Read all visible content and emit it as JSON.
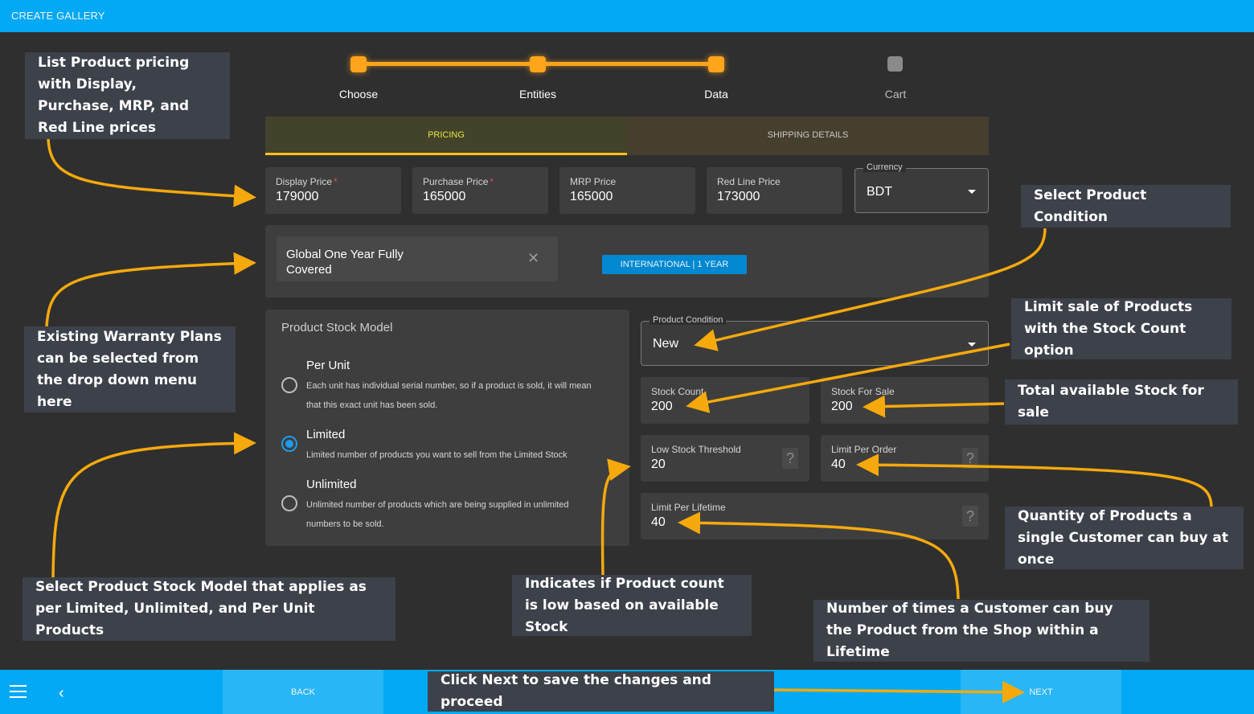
{
  "app": {
    "title": "CREATE GALLERY"
  },
  "stepper": {
    "steps": [
      {
        "label": "Choose",
        "state": "complete"
      },
      {
        "label": "Entities",
        "state": "complete"
      },
      {
        "label": "Data",
        "state": "current"
      },
      {
        "label": "Cart",
        "state": "inactive"
      }
    ]
  },
  "tabs": [
    {
      "label": "PRICING",
      "active": true
    },
    {
      "label": "SHIPPING DETAILS",
      "active": false
    }
  ],
  "pricing": {
    "display_price": {
      "label": "Display Price",
      "required": "*",
      "value": "179000"
    },
    "purchase_price": {
      "label": "Purchase Price",
      "required": "*",
      "value": "165000"
    },
    "mrp_price": {
      "label": "MRP Price",
      "value": "165000"
    },
    "red_line_price": {
      "label": "Red Line Price",
      "value": "173000"
    },
    "currency": {
      "label": "Currency",
      "value": "BDT"
    }
  },
  "warranty": {
    "selected": "Global One Year Fully Covered",
    "remove_icon": "close-icon",
    "badge": "INTERNATIONAL | 1 YEAR"
  },
  "stock_model": {
    "title": "Product Stock Model",
    "selected": "Limited",
    "options": [
      {
        "title": "Per Unit",
        "description": "Each unit has individual serial number, so if a product is sold, it will mean that this exact unit has been sold.",
        "checked": false
      },
      {
        "title": "Limited",
        "description": "Limited number of products you want to sell from the Limited Stock",
        "checked": true
      },
      {
        "title": "Unlimited",
        "description": "Unlimited number of products which are being supplied in unlimited numbers to be sold.",
        "checked": false
      }
    ]
  },
  "inventory": {
    "product_condition": {
      "label": "Product Condition",
      "value": "New"
    },
    "stock_count": {
      "label": "Stock Count",
      "value": "200"
    },
    "stock_for_sale": {
      "label": "Stock For Sale",
      "value": "200"
    },
    "low_stock_threshold": {
      "label": "Low Stock Threshold",
      "value": "20",
      "help": "?"
    },
    "limit_per_order": {
      "label": "Limit Per Order",
      "value": "40",
      "help": "?"
    },
    "limit_per_lifetime": {
      "label": "Limit Per Lifetime",
      "value": "40",
      "help": "?"
    }
  },
  "annotations": {
    "pricing": "List Product pricing with Display, Purchase, MRP, and Red Line prices",
    "warranty": "Existing Warranty Plans can be selected from the drop down menu here",
    "stock_model": "Select Product Stock Model that applies as per Limited, Unlimited, and Per Unit Products",
    "low_stock": "Indicates if Product count is low based on available Stock",
    "lifetime": "Number of times a Customer can buy the Product from the Shop within a Lifetime",
    "condition": "Select Product Condition",
    "stock_count": "Limit sale of Products with the Stock Count option",
    "stock_for_sale": "Total available Stock for sale",
    "per_order": "Quantity of Products a single Customer can buy at once",
    "next": "Click Next to save the changes and proceed"
  },
  "footer": {
    "back_label": "BACK",
    "next_label": "NEXT"
  },
  "colors": {
    "primary": "#03a9f4",
    "accent": "#ffa41b",
    "annotation_bg": "#3c414a",
    "badge": "#0288d1"
  }
}
